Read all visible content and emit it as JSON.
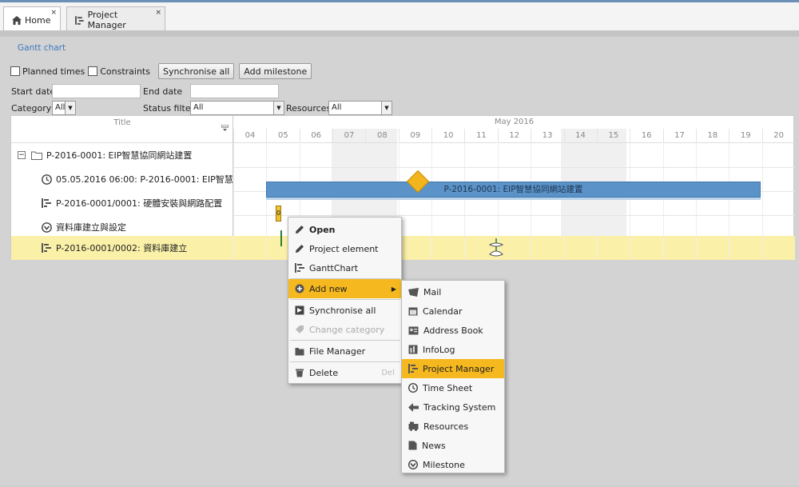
{
  "tabs": [
    {
      "label": "Home",
      "close": "×"
    },
    {
      "label": "Project Manager",
      "close": "×"
    }
  ],
  "breadcrumb": "Gantt chart",
  "toolbar": {
    "planned_times": "Planned times",
    "constraints": "Constraints",
    "synchronise_all": "Synchronise all",
    "add_milestone": "Add milestone"
  },
  "filters": {
    "start_date_label": "Start date",
    "end_date_label": "End date",
    "category_label": "Category",
    "category_value": "All",
    "status_label": "Status filter",
    "status_value": "All",
    "resources_label": "Resources",
    "resources_value": "All"
  },
  "gantt": {
    "title_header": "Title",
    "month": "May 2016",
    "days": [
      "04",
      "05",
      "06",
      "07",
      "08",
      "09",
      "10",
      "11",
      "12",
      "13",
      "14",
      "15",
      "16",
      "17",
      "18",
      "19",
      "20"
    ],
    "rows": [
      {
        "label": "P-2016-0001: EIP智慧協同網站建置",
        "expander": "−"
      },
      {
        "label": "05.05.2016 06:00: P-2016-0001: EIP智慧"
      },
      {
        "label": "P-2016-0001/0001: 硬體安裝與網路配置"
      },
      {
        "label": "資料庫建立與設定"
      },
      {
        "label": "P-2016-0001/0002: 資料庫建立"
      }
    ],
    "bar_label": "P-2016-0001: EIP智慧協同網站建置",
    "event_label": "0"
  },
  "context_menu": {
    "items": [
      {
        "label": "Open"
      },
      {
        "label": "Project element"
      },
      {
        "label": "GanttChart"
      },
      {
        "label": "Add new"
      },
      {
        "label": "Synchronise all"
      },
      {
        "label": "Change category"
      },
      {
        "label": "File Manager"
      },
      {
        "label": "Delete",
        "shortcut": "Del"
      }
    ]
  },
  "submenu": {
    "items": [
      {
        "label": "Mail"
      },
      {
        "label": "Calendar"
      },
      {
        "label": "Address Book"
      },
      {
        "label": "InfoLog"
      },
      {
        "label": "Project Manager"
      },
      {
        "label": "Time Sheet"
      },
      {
        "label": "Tracking System"
      },
      {
        "label": "Resources"
      },
      {
        "label": "News"
      },
      {
        "label": "Milestone"
      }
    ]
  },
  "colors": {
    "accent": "#f5b81e",
    "bar": "#5b93c8",
    "selected_row": "#faf0a8",
    "milestone": "#f2b51d"
  }
}
